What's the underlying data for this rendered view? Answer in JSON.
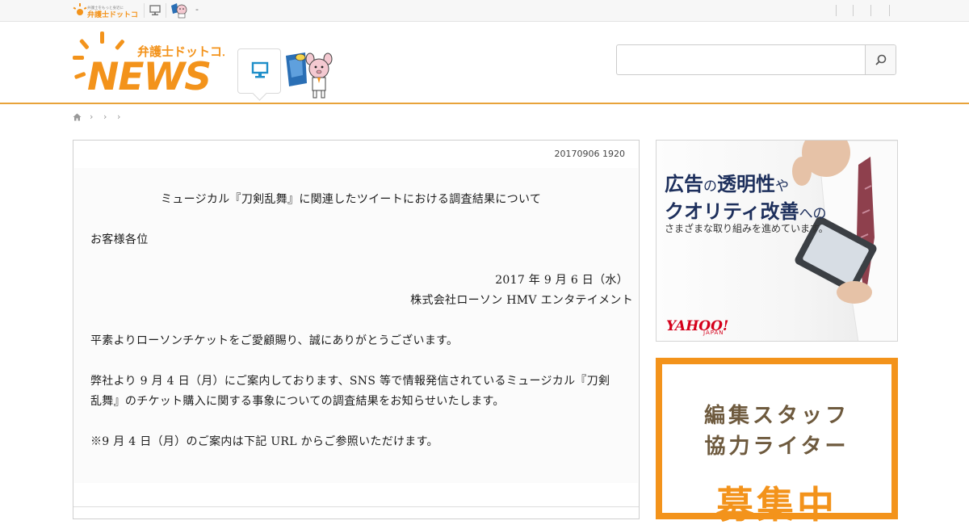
{
  "topbar": {
    "site_logo_tagline": "弁護士をもっと身近に",
    "site_logo_text": "弁護士ドットコム",
    "separator_text": "-"
  },
  "header": {
    "logo_small": "弁護士ドットコム",
    "logo_large": "NEWS",
    "search": {
      "placeholder": "",
      "value": ""
    }
  },
  "breadcrumb": {
    "items": [
      "",
      "",
      ""
    ]
  },
  "article": {
    "timestamp": "20170906 1920",
    "document": {
      "title": "ミュージカル『刀剣乱舞』に関連したツイートにおける調査結果について",
      "salutation": "お客様各位",
      "date": "2017 年 9 月 6 日（水）",
      "company": "株式会社ローソン HMV エンタテイメント",
      "p1": "平素よりローソンチケットをご愛顧賜り、誠にありがとうございます。",
      "p2_line1": "弊社より 9 月 4 日（月）にご案内しております、SNS 等で情報発信されているミュージカル『刀剣",
      "p2_line2": "乱舞』のチケット購入に関する事象についての調査結果をお知らせいたします。",
      "p3": "※9 月 4 日（月）のご案内は下記 URL からご参照いただけます。"
    }
  },
  "ad": {
    "line1_a": "広告",
    "line1_b": "の",
    "line1_c": "透明性",
    "line1_d": "や",
    "line2_a": "クオリティ改善",
    "line2_b": "への",
    "sub": "さまざまな取り組みを進めています。",
    "brand": "YAHOO!",
    "brand_sub": "JAPAN"
  },
  "recruit": {
    "line1": "編集スタッフ",
    "line2": "協力ライター",
    "line3": "募集中"
  },
  "colors": {
    "brand_orange": "#f3931b",
    "header_rule": "#e8a33a",
    "ad_navy": "#1d2f5c",
    "yahoo_red": "#d4001b",
    "recruit_brown": "#6e5a3e"
  },
  "icons": {
    "pc": "desktop-computer-icon",
    "search": "magnifier-icon",
    "home": "home-icon",
    "chevron": "chevron-right-icon"
  }
}
